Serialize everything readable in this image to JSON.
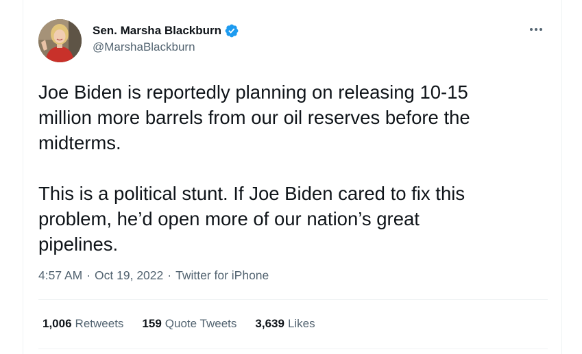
{
  "author": {
    "display_name": "Sen. Marsha Blackburn",
    "handle": "@MarshaBlackburn",
    "verified": true,
    "verified_color": "#1d9bf0"
  },
  "tweet": {
    "paragraphs": [
      "Joe Biden is reportedly planning on releasing 10-15\nmillion more barrels from our oil reserves before the\nmidterms.",
      "This is a political stunt. If Joe Biden cared to fix this\nproblem, he’d open more of our nation’s great\npipelines."
    ]
  },
  "meta": {
    "time": "4:57 AM",
    "separator": "·",
    "date": "Oct 19, 2022",
    "source": "Twitter for iPhone"
  },
  "stats": {
    "retweets_count": "1,006",
    "retweets_label": "Retweets",
    "quotes_count": "159",
    "quotes_label": "Quote Tweets",
    "likes_count": "3,639",
    "likes_label": "Likes"
  },
  "icons": {
    "more": "more-options-icon",
    "verified": "verified-badge-icon"
  },
  "colors": {
    "text_primary": "#0f1419",
    "text_secondary": "#536471",
    "divider": "#eff3f4"
  }
}
